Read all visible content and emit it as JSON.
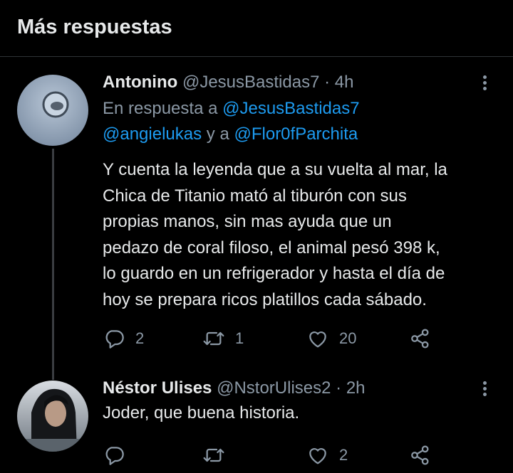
{
  "header": {
    "title": "Más respuestas"
  },
  "tweets": [
    {
      "name": "Antonino",
      "handle": "@JesusBastidas7",
      "separator": "·",
      "time": "4h",
      "replying_prefix": "En respuesta a",
      "mention_1": "@JesusBastidas7",
      "mention_2": "@angielukas",
      "replying_and": "y a",
      "mention_3": "@Flor0fParchita",
      "text_lines": [
        "Y cuenta la leyenda que a su vuelta al mar, la",
        "Chica de Titanio mató al tiburón con sus",
        "propias manos, sin mas ayuda que un",
        "pedazo de coral filoso, el animal pesó 398 k,",
        "lo guardo en un refrigerador y hasta el día de",
        "hoy se prepara ricos platillos cada sábado."
      ],
      "replies": "2",
      "retweets": "1",
      "likes": "20",
      "icons": [
        "reply-icon",
        "retweet-icon",
        "like-icon",
        "share-icon",
        "more-icon"
      ]
    },
    {
      "name": "Néstor Ulises",
      "handle": "@NstorUlises2",
      "separator": "·",
      "time": "2h",
      "text": "Joder, que buena historia.",
      "replies": "",
      "retweets": "",
      "likes": "2",
      "icons": [
        "reply-icon",
        "retweet-icon",
        "like-icon",
        "share-icon",
        "more-icon"
      ]
    }
  ],
  "colors": {
    "background": "#000000",
    "text": "#e7e9ea",
    "secondary": "#8b98a5",
    "link": "#1d9bf0",
    "divider": "#2f3336"
  }
}
